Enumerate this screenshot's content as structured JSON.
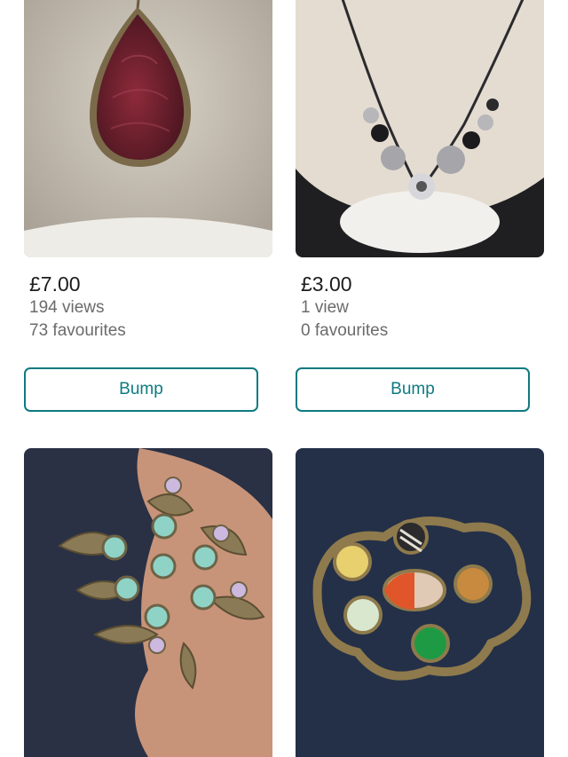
{
  "items": [
    {
      "price": "£7.00",
      "views": "194 views",
      "favourites": "73 favourites",
      "button": "Bump"
    },
    {
      "price": "£3.00",
      "views": "1 view",
      "favourites": "0 favourites",
      "button": "Bump"
    },
    {
      "price": "",
      "views": "",
      "favourites": "",
      "button": ""
    },
    {
      "price": "",
      "views": "",
      "favourites": "",
      "button": ""
    }
  ],
  "colors": {
    "accent": "#0f7a80"
  }
}
